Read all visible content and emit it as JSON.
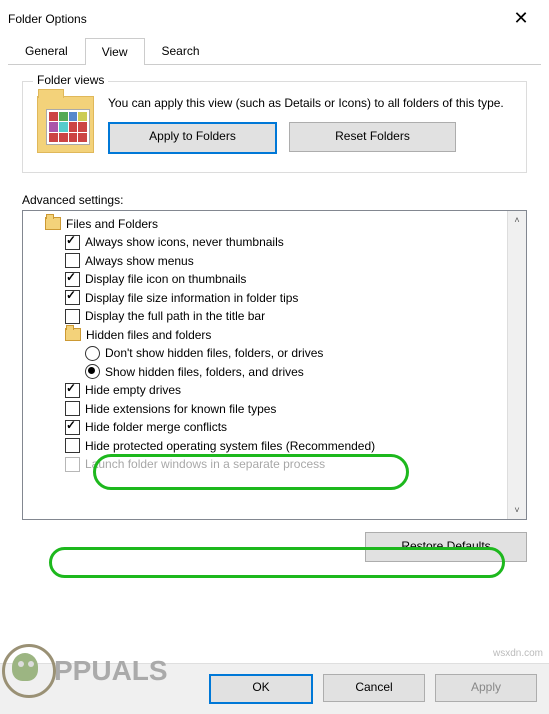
{
  "dialog": {
    "title": "Folder Options"
  },
  "tabs": {
    "general": "General",
    "view": "View",
    "search": "Search",
    "active": "view"
  },
  "folderViews": {
    "legend": "Folder views",
    "description": "You can apply this view (such as Details or Icons) to all folders of this type.",
    "applyBtn": "Apply to Folders",
    "resetBtn": "Reset Folders"
  },
  "advanced": {
    "label": "Advanced settings:",
    "root": "Files and Folders",
    "items": [
      {
        "type": "check",
        "checked": true,
        "label": "Always show icons, never thumbnails"
      },
      {
        "type": "check",
        "checked": false,
        "label": "Always show menus"
      },
      {
        "type": "check",
        "checked": true,
        "label": "Display file icon on thumbnails"
      },
      {
        "type": "check",
        "checked": true,
        "label": "Display file size information in folder tips"
      },
      {
        "type": "check",
        "checked": false,
        "label": "Display the full path in the title bar"
      }
    ],
    "subgroup": "Hidden files and folders",
    "radios": [
      {
        "checked": false,
        "label": "Don't show hidden files, folders, or drives"
      },
      {
        "checked": true,
        "label": "Show hidden files, folders, and drives"
      }
    ],
    "items2": [
      {
        "type": "check",
        "checked": true,
        "label": "Hide empty drives"
      },
      {
        "type": "check",
        "checked": false,
        "label": "Hide extensions for known file types"
      },
      {
        "type": "check",
        "checked": true,
        "label": "Hide folder merge conflicts"
      },
      {
        "type": "check",
        "checked": false,
        "label": "Hide protected operating system files (Recommended)"
      },
      {
        "type": "check",
        "checked": false,
        "label": "Launch folder windows in a separate process"
      }
    ],
    "restoreBtn": "Restore Defaults"
  },
  "buttons": {
    "ok": "OK",
    "cancel": "Cancel",
    "apply": "Apply"
  },
  "watermark": {
    "text": "PPUALS",
    "site": "wsxdn.com"
  }
}
